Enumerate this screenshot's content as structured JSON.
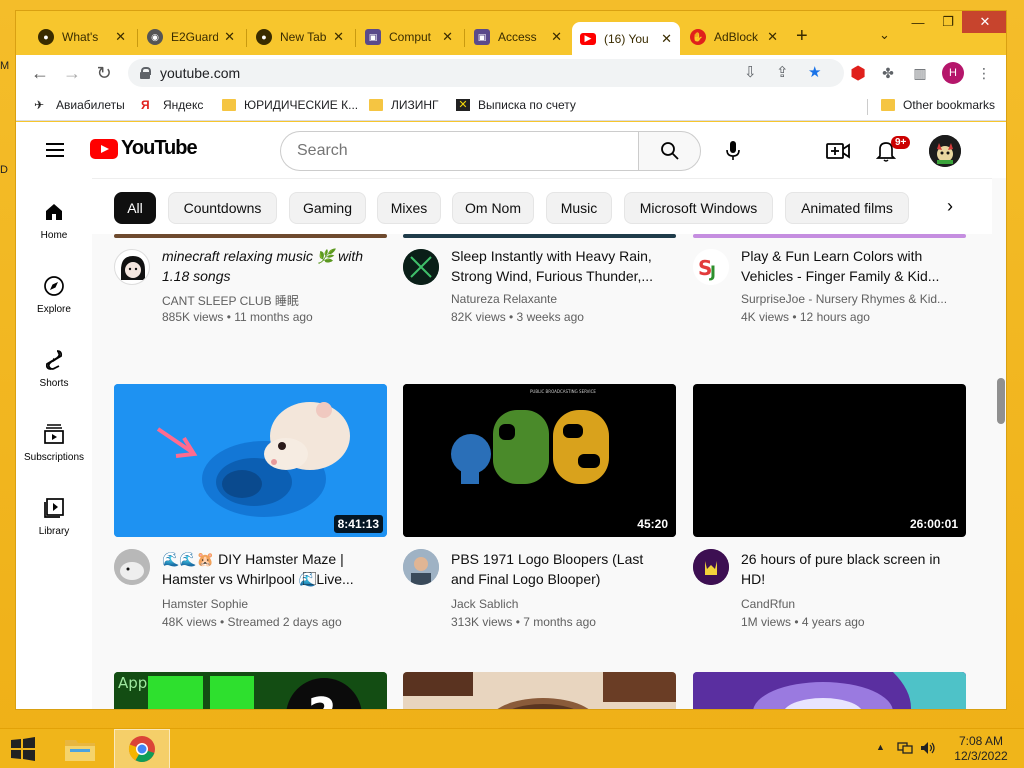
{
  "desktop": {
    "left_stubs": [
      "M",
      "D"
    ]
  },
  "browser": {
    "tabs": [
      {
        "title": "What's",
        "icon": "github-icon",
        "active": false
      },
      {
        "title": "E2Guard",
        "icon": "globe-icon",
        "active": false
      },
      {
        "title": "New Tab",
        "icon": "github-icon",
        "active": false
      },
      {
        "title": "Comput",
        "icon": "extension-icon",
        "active": false
      },
      {
        "title": "Access",
        "icon": "extension-icon",
        "active": false
      },
      {
        "title": "(16) You",
        "icon": "youtube-icon",
        "active": true
      },
      {
        "title": "AdBlock",
        "icon": "adblock-icon",
        "active": false
      }
    ],
    "new_tab_symbol": "+",
    "tab_search_symbol": "⌄",
    "window_controls": {
      "minimize": "—",
      "maximize": "❐",
      "close": "✕"
    },
    "nav": {
      "back": "←",
      "forward": "→",
      "reload": "↻"
    },
    "url": "youtube.com",
    "bookmarks": [
      {
        "label": "Авиабилеты",
        "icon": "plane-icon"
      },
      {
        "label": "Яндекс",
        "icon": "yandex-icon"
      },
      {
        "label": "ЮРИДИЧЕСКИЕ К...",
        "icon": "folder-icon"
      },
      {
        "label": "ЛИЗИНГ",
        "icon": "folder-icon"
      },
      {
        "label": "Выписка по счету",
        "icon": "bank-icon"
      }
    ],
    "other_bookmarks": "Other bookmarks",
    "profile_initial": "H"
  },
  "youtube": {
    "logo_text": "YouTube",
    "search_placeholder": "Search",
    "notification_count": "9+",
    "sidebar": [
      {
        "label": "Home",
        "icon": "home-icon"
      },
      {
        "label": "Explore",
        "icon": "compass-icon"
      },
      {
        "label": "Shorts",
        "icon": "shorts-icon"
      },
      {
        "label": "Subscriptions",
        "icon": "subscriptions-icon"
      },
      {
        "label": "Library",
        "icon": "library-icon"
      }
    ],
    "chips": [
      "All",
      "Countdowns",
      "Gaming",
      "Mixes",
      "Om Nom",
      "Music",
      "Microsoft Windows",
      "Animated films"
    ],
    "videos_row1": [
      {
        "title": "minecraft relaxing music 🌿 with 1.18 songs",
        "channel": "CANT SLEEP CLUB 睡眠",
        "meta": "885K views • 11 months ago"
      },
      {
        "title": "Sleep Instantly with Heavy Rain, Strong Wind, Furious Thunder,...",
        "channel": "Natureza Relaxante",
        "meta": "82K views • 3 weeks ago"
      },
      {
        "title": "Play & Fun Learn Colors with Vehicles - Finger Family & Kid...",
        "channel": "SurpriseJoe - Nursery Rhymes & Kid...",
        "meta": "4K views • 12 hours ago"
      }
    ],
    "videos_row2": [
      {
        "title": "🌊🌊🐹 DIY Hamster Maze | Hamster vs Whirlpool 🌊⃞Live...",
        "channel": "Hamster Sophie",
        "meta": "48K views • Streamed 2 days ago",
        "duration": "8:41:13"
      },
      {
        "title": "PBS 1971 Logo Bloopers (Last and Final Logo Blooper)",
        "channel": "Jack Sablich",
        "meta": "313K views • 7 months ago",
        "duration": "45:20"
      },
      {
        "title": "26 hours of pure black screen in HD!",
        "channel": "CandRfun",
        "meta": "1M views • 4 years ago",
        "duration": "26:00:01"
      }
    ],
    "pbs_caption": "PUBLIC BROADCASTING SERVICE",
    "pbs_letters": "PBS",
    "apps_thumb_label": "Apps"
  },
  "taskbar": {
    "apps": [
      {
        "name": "file-explorer",
        "icon": "folder-icon",
        "active": false
      },
      {
        "name": "chrome",
        "icon": "chrome-icon",
        "active": true
      }
    ],
    "time": "7:08 AM",
    "date": "12/3/2022",
    "tray_arrow": "▲"
  }
}
